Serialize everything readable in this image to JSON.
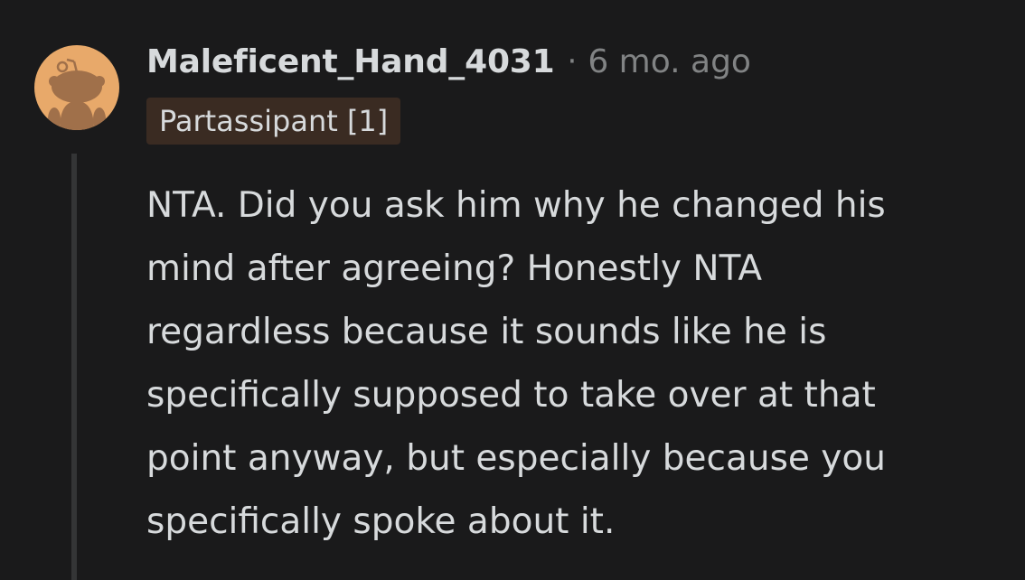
{
  "comment": {
    "avatar_icon": "snoo-avatar-icon",
    "username": "Maleficent_Hand_4031",
    "separator": "·",
    "timestamp": "6 mo. ago",
    "flair": "Partassipant [1]",
    "body_lines": [
      "NTA. Did you ask him why he changed his",
      "mind after agreeing? Honestly NTA",
      "regardless because it sounds like he is",
      "specifically supposed to take over at that",
      "point anyway, but especially because you",
      "specifically spoke about it."
    ]
  },
  "colors": {
    "background": "#1a1a1b",
    "text": "#d7dadc",
    "meta": "#818384",
    "avatar_bg": "#e8a96a",
    "snoo": "#a0704a",
    "flair_bg": "#3a2b22",
    "thread_line": "#343536"
  }
}
